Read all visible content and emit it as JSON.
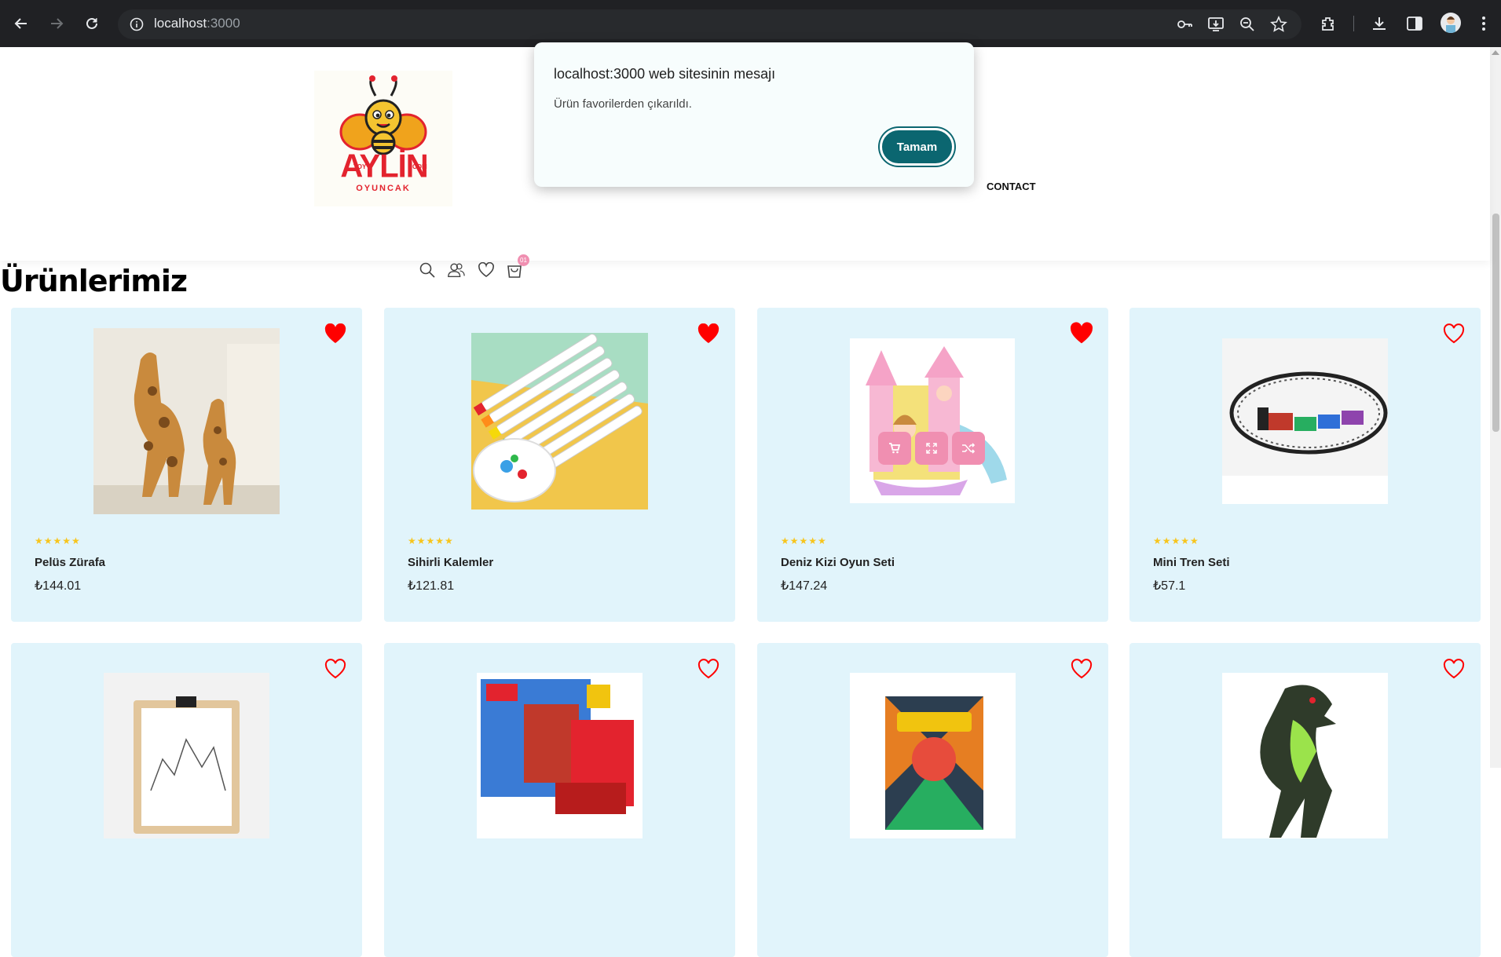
{
  "browser": {
    "url_host": "localhost",
    "url_port": ":3000"
  },
  "header": {
    "logo": {
      "main": "AYLİN",
      "sub": "OYUNCAK",
      "toy": "TOY",
      "com": "COM"
    },
    "cart_count": "01",
    "nav_contact": "CONTACT"
  },
  "main": {
    "title": "Ürünlerimiz",
    "products": [
      {
        "name": "Pelüs Zürafa",
        "price": "₺144.01",
        "rating": "★★★★★",
        "favorite": true
      },
      {
        "name": "Sihirli Kalemler",
        "price": "₺121.81",
        "rating": "★★★★★",
        "favorite": true
      },
      {
        "name": "Deniz Kizi Oyun Seti",
        "price": "₺147.24",
        "rating": "★★★★★",
        "favorite": true
      },
      {
        "name": "Mini Tren Seti",
        "price": "₺57.1",
        "rating": "★★★★★",
        "favorite": false
      }
    ]
  },
  "dialog": {
    "title": "localhost:3000 web sitesinin mesajı",
    "message": "Ürün favorilerden çıkarıldı.",
    "ok_label": "Tamam"
  },
  "colors": {
    "card_bg": "#e1f4fb",
    "heart": "#ff0000",
    "accent_pink": "#f08fb1",
    "dialog_button": "#0b6670"
  }
}
